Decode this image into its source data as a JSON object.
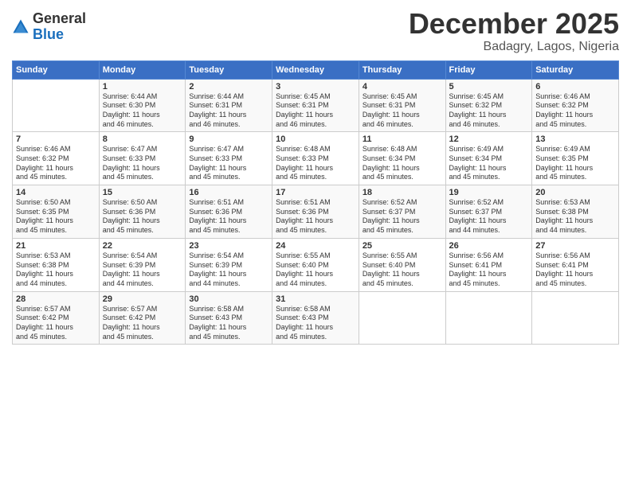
{
  "logo": {
    "general": "General",
    "blue": "Blue"
  },
  "header": {
    "month": "December 2025",
    "location": "Badagry, Lagos, Nigeria"
  },
  "weekdays": [
    "Sunday",
    "Monday",
    "Tuesday",
    "Wednesday",
    "Thursday",
    "Friday",
    "Saturday"
  ],
  "weeks": [
    [
      {
        "day": "",
        "info": ""
      },
      {
        "day": "1",
        "info": "Sunrise: 6:44 AM\nSunset: 6:30 PM\nDaylight: 11 hours\nand 46 minutes."
      },
      {
        "day": "2",
        "info": "Sunrise: 6:44 AM\nSunset: 6:31 PM\nDaylight: 11 hours\nand 46 minutes."
      },
      {
        "day": "3",
        "info": "Sunrise: 6:45 AM\nSunset: 6:31 PM\nDaylight: 11 hours\nand 46 minutes."
      },
      {
        "day": "4",
        "info": "Sunrise: 6:45 AM\nSunset: 6:31 PM\nDaylight: 11 hours\nand 46 minutes."
      },
      {
        "day": "5",
        "info": "Sunrise: 6:45 AM\nSunset: 6:32 PM\nDaylight: 11 hours\nand 46 minutes."
      },
      {
        "day": "6",
        "info": "Sunrise: 6:46 AM\nSunset: 6:32 PM\nDaylight: 11 hours\nand 45 minutes."
      }
    ],
    [
      {
        "day": "7",
        "info": "Sunrise: 6:46 AM\nSunset: 6:32 PM\nDaylight: 11 hours\nand 45 minutes."
      },
      {
        "day": "8",
        "info": "Sunrise: 6:47 AM\nSunset: 6:33 PM\nDaylight: 11 hours\nand 45 minutes."
      },
      {
        "day": "9",
        "info": "Sunrise: 6:47 AM\nSunset: 6:33 PM\nDaylight: 11 hours\nand 45 minutes."
      },
      {
        "day": "10",
        "info": "Sunrise: 6:48 AM\nSunset: 6:33 PM\nDaylight: 11 hours\nand 45 minutes."
      },
      {
        "day": "11",
        "info": "Sunrise: 6:48 AM\nSunset: 6:34 PM\nDaylight: 11 hours\nand 45 minutes."
      },
      {
        "day": "12",
        "info": "Sunrise: 6:49 AM\nSunset: 6:34 PM\nDaylight: 11 hours\nand 45 minutes."
      },
      {
        "day": "13",
        "info": "Sunrise: 6:49 AM\nSunset: 6:35 PM\nDaylight: 11 hours\nand 45 minutes."
      }
    ],
    [
      {
        "day": "14",
        "info": "Sunrise: 6:50 AM\nSunset: 6:35 PM\nDaylight: 11 hours\nand 45 minutes."
      },
      {
        "day": "15",
        "info": "Sunrise: 6:50 AM\nSunset: 6:36 PM\nDaylight: 11 hours\nand 45 minutes."
      },
      {
        "day": "16",
        "info": "Sunrise: 6:51 AM\nSunset: 6:36 PM\nDaylight: 11 hours\nand 45 minutes."
      },
      {
        "day": "17",
        "info": "Sunrise: 6:51 AM\nSunset: 6:36 PM\nDaylight: 11 hours\nand 45 minutes."
      },
      {
        "day": "18",
        "info": "Sunrise: 6:52 AM\nSunset: 6:37 PM\nDaylight: 11 hours\nand 45 minutes."
      },
      {
        "day": "19",
        "info": "Sunrise: 6:52 AM\nSunset: 6:37 PM\nDaylight: 11 hours\nand 44 minutes."
      },
      {
        "day": "20",
        "info": "Sunrise: 6:53 AM\nSunset: 6:38 PM\nDaylight: 11 hours\nand 44 minutes."
      }
    ],
    [
      {
        "day": "21",
        "info": "Sunrise: 6:53 AM\nSunset: 6:38 PM\nDaylight: 11 hours\nand 44 minutes."
      },
      {
        "day": "22",
        "info": "Sunrise: 6:54 AM\nSunset: 6:39 PM\nDaylight: 11 hours\nand 44 minutes."
      },
      {
        "day": "23",
        "info": "Sunrise: 6:54 AM\nSunset: 6:39 PM\nDaylight: 11 hours\nand 44 minutes."
      },
      {
        "day": "24",
        "info": "Sunrise: 6:55 AM\nSunset: 6:40 PM\nDaylight: 11 hours\nand 44 minutes."
      },
      {
        "day": "25",
        "info": "Sunrise: 6:55 AM\nSunset: 6:40 PM\nDaylight: 11 hours\nand 45 minutes."
      },
      {
        "day": "26",
        "info": "Sunrise: 6:56 AM\nSunset: 6:41 PM\nDaylight: 11 hours\nand 45 minutes."
      },
      {
        "day": "27",
        "info": "Sunrise: 6:56 AM\nSunset: 6:41 PM\nDaylight: 11 hours\nand 45 minutes."
      }
    ],
    [
      {
        "day": "28",
        "info": "Sunrise: 6:57 AM\nSunset: 6:42 PM\nDaylight: 11 hours\nand 45 minutes."
      },
      {
        "day": "29",
        "info": "Sunrise: 6:57 AM\nSunset: 6:42 PM\nDaylight: 11 hours\nand 45 minutes."
      },
      {
        "day": "30",
        "info": "Sunrise: 6:58 AM\nSunset: 6:43 PM\nDaylight: 11 hours\nand 45 minutes."
      },
      {
        "day": "31",
        "info": "Sunrise: 6:58 AM\nSunset: 6:43 PM\nDaylight: 11 hours\nand 45 minutes."
      },
      {
        "day": "",
        "info": ""
      },
      {
        "day": "",
        "info": ""
      },
      {
        "day": "",
        "info": ""
      }
    ]
  ]
}
